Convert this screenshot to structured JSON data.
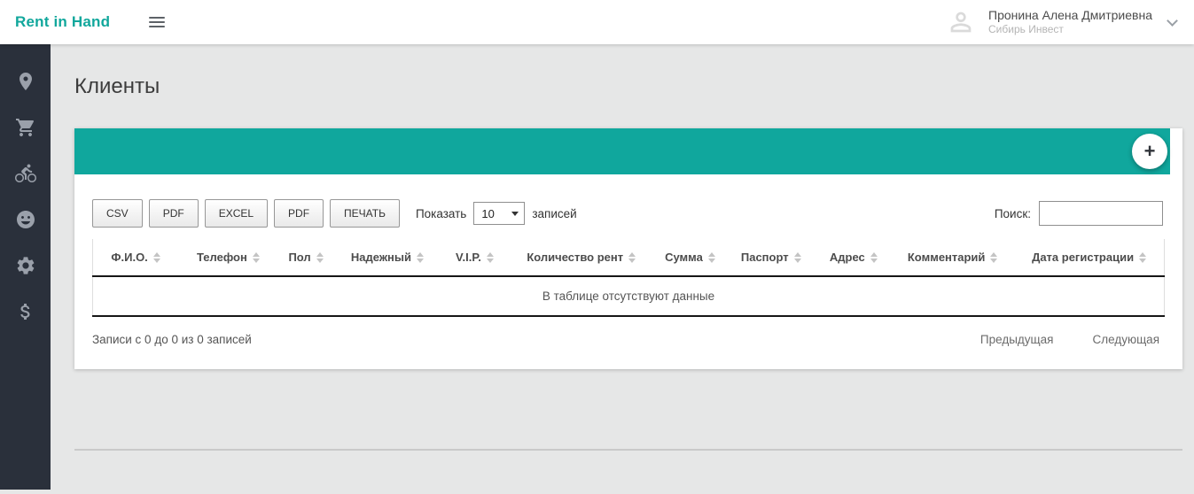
{
  "app": {
    "brand": "Rent in Hand"
  },
  "header": {
    "user_name": "Пронина Алена Дмитриевна",
    "user_org": "Сибирь Инвест"
  },
  "sidebar": {
    "items": [
      {
        "icon": "place-icon"
      },
      {
        "icon": "cart-icon"
      },
      {
        "icon": "bike-icon"
      },
      {
        "icon": "face-icon"
      },
      {
        "icon": "gear-icon"
      },
      {
        "icon": "dollar-icon"
      }
    ]
  },
  "page": {
    "title": "Клиенты"
  },
  "controls": {
    "add": "+"
  },
  "toolbar": {
    "buttons": [
      "CSV",
      "PDF",
      "EXCEL",
      "PDF",
      "ПЕЧАТЬ"
    ],
    "length_prefix": "Показать",
    "length_suffix": "записей",
    "page_size": "10",
    "search_label": "Поиск:",
    "search_value": ""
  },
  "table": {
    "columns": [
      "Ф.И.О.",
      "Телефон",
      "Пол",
      "Надежный",
      "V.I.P.",
      "Количество рент",
      "Сумма",
      "Паспорт",
      "Адрес",
      "Комментарий",
      "Дата регистрации"
    ],
    "empty_text": "В таблице отсутствуют данные"
  },
  "footer": {
    "info": "Записи с 0 до 0 из 0 записей",
    "prev": "Предыдущая",
    "next": "Следующая"
  },
  "colors": {
    "accent": "#10a79d",
    "sidebar_bg": "#2a303b",
    "page_bg": "#e6e7e7"
  }
}
